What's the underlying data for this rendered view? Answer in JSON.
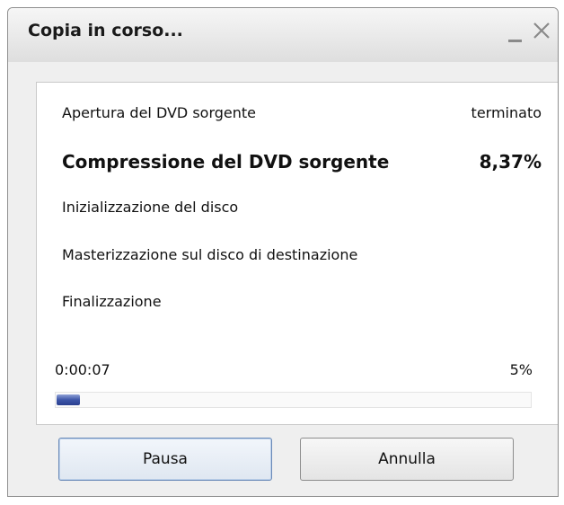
{
  "window": {
    "title": "Copia in corso..."
  },
  "steps": [
    {
      "label": "Apertura del DVD sorgente",
      "status": "terminato"
    },
    {
      "label": "Compressione del DVD sorgente",
      "status": "8,37%"
    },
    {
      "label": "Inizializzazione del disco",
      "status": ""
    },
    {
      "label": "Masterizzazione sul disco di destinazione",
      "status": ""
    },
    {
      "label": "Finalizzazione",
      "status": ""
    }
  ],
  "progress": {
    "elapsed": "0:00:07",
    "percent_label": "5%",
    "value": 0.05
  },
  "buttons": {
    "pause_label": "Pausa",
    "cancel_label": "Annulla"
  },
  "icons": {
    "minimize": "minimize-icon",
    "close": "close-icon"
  },
  "colors": {
    "progress_fill": "#3d56a8",
    "window_bg": "#efefef"
  }
}
